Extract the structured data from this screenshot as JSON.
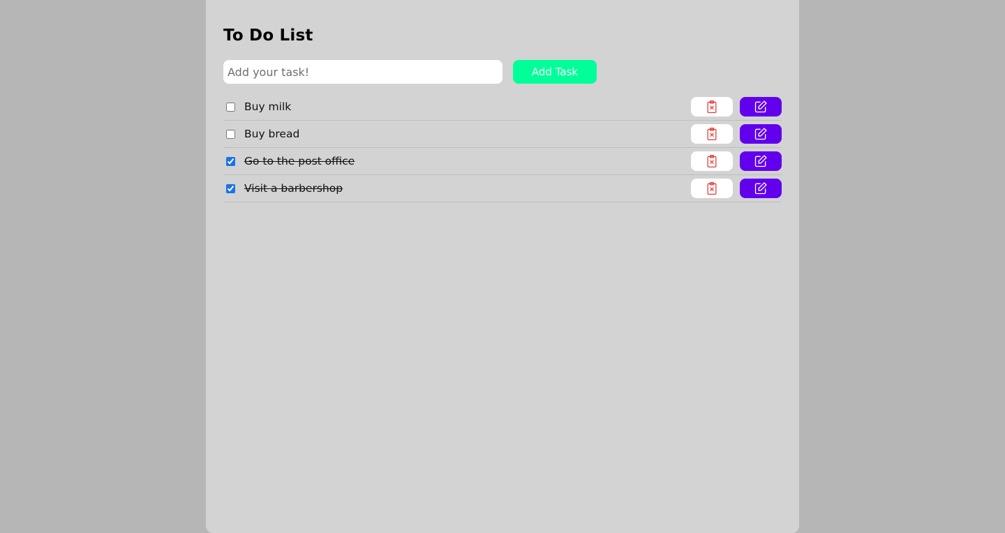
{
  "app": {
    "title": "To Do List"
  },
  "input": {
    "placeholder": "Add your task!",
    "value": ""
  },
  "add_button": {
    "label": "Add Task"
  },
  "tasks": [
    {
      "text": "Buy milk",
      "done": false
    },
    {
      "text": "Buy bread",
      "done": false
    },
    {
      "text": "Go to the post office",
      "done": true
    },
    {
      "text": "Visit a barbershop",
      "done": true
    }
  ],
  "icons": {
    "delete": "clipboard-x-icon",
    "edit": "pencil-square-icon"
  },
  "colors": {
    "page_background": "#b6b6b6",
    "panel_background": "#d3d3d3",
    "add_button": "#00ff99",
    "edit_button": "#6200ee",
    "delete_icon": "#e53935",
    "checkbox_accent": "#1a73e8"
  }
}
